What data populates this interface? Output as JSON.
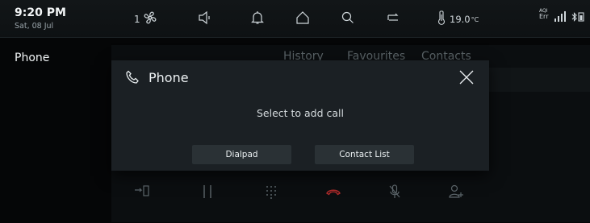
{
  "status": {
    "time": "9:20 PM",
    "date": "Sat, 08 Jul",
    "fan_level": "1",
    "temperature": "19.0",
    "temperature_unit": "°C",
    "aqi_label": "AQI",
    "aqi_value": "Err"
  },
  "page": {
    "title": "Phone"
  },
  "tabs": [
    "History",
    "Favourites",
    "Contacts"
  ],
  "modal": {
    "title": "Phone",
    "message": "Select to add call",
    "buttons": {
      "dialpad": "Dialpad",
      "contact_list": "Contact List"
    }
  },
  "colors": {
    "accent_red": "#b12b2b",
    "modal_bg": "#1b2024",
    "button_bg": "#2a3135"
  }
}
